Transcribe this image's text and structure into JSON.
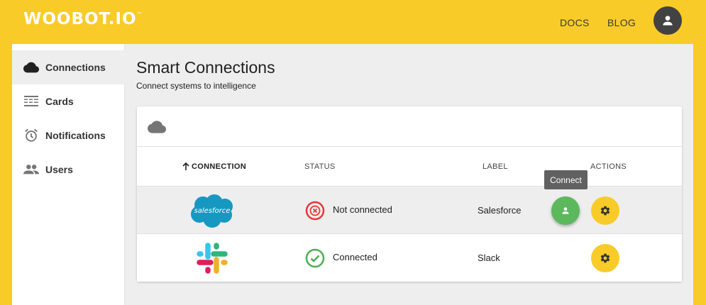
{
  "header": {
    "logo": "WOOBOT.IO",
    "logo_tm": "™",
    "nav": {
      "docs": "DOCS",
      "blog": "BLOG"
    },
    "avatar_icon": "account-circle-icon",
    "bg_color": "#f9cb28"
  },
  "sidebar": {
    "items": [
      {
        "label": "Connections",
        "icon": "cloud-icon",
        "active": true
      },
      {
        "label": "Cards",
        "icon": "cards-icon",
        "active": false
      },
      {
        "label": "Notifications",
        "icon": "alarm-icon",
        "active": false
      },
      {
        "label": "Users",
        "icon": "people-icon",
        "active": false
      }
    ]
  },
  "main": {
    "title": "Smart Connections",
    "subtitle": "Connect systems to intelligence",
    "table": {
      "columns": {
        "connection": "CONNECTION",
        "status": "STATUS",
        "label": "LABEL",
        "actions": "ACTIONS"
      },
      "sort": {
        "column": "connection",
        "direction": "ascending"
      },
      "rows": [
        {
          "connection": "salesforce",
          "status": "Not connected",
          "status_type": "error",
          "label": "Salesforce",
          "can_connect": true
        },
        {
          "connection": "slack",
          "status": "Connected",
          "status_type": "success",
          "label": "Slack",
          "can_connect": false
        }
      ]
    },
    "tooltip": "Connect"
  },
  "colors": {
    "accent": "#f9cb28",
    "success": "#4caf50",
    "error": "#e53935",
    "connect_button": "#5cb85c",
    "salesforce": "#1798c1"
  }
}
